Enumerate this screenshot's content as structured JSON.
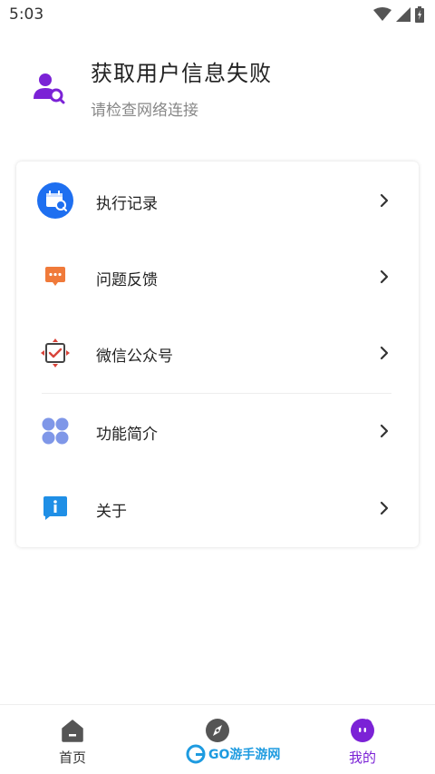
{
  "status_bar": {
    "time": "5:03"
  },
  "profile": {
    "title": "获取用户信息失败",
    "subtitle": "请检查网络连接"
  },
  "menu": [
    {
      "label": "执行记录",
      "icon": "calendar-search-icon"
    },
    {
      "label": "问题反馈",
      "icon": "chat-bubble-icon"
    },
    {
      "label": "微信公众号",
      "icon": "wechat-official-icon"
    },
    {
      "label": "功能简介",
      "icon": "apps-grid-icon"
    },
    {
      "label": "关于",
      "icon": "info-icon"
    }
  ],
  "bottom_nav": {
    "tabs": [
      {
        "label": "首页",
        "icon": "home-icon",
        "active": false
      },
      {
        "label": "",
        "icon": "compass-icon",
        "active": false
      },
      {
        "label": "我的",
        "icon": "profile-face-icon",
        "active": true
      }
    ]
  },
  "watermark": {
    "text": "GO游手游网"
  },
  "colors": {
    "accent": "#7b22d6",
    "primary_blue": "#1e6ff0",
    "feedback_orange": "#f07a3a",
    "wechat_red": "#d9443a",
    "grid_blue": "#7f97e8",
    "info_blue": "#1f8fe6",
    "text": "#222222",
    "subtext": "#888888"
  }
}
